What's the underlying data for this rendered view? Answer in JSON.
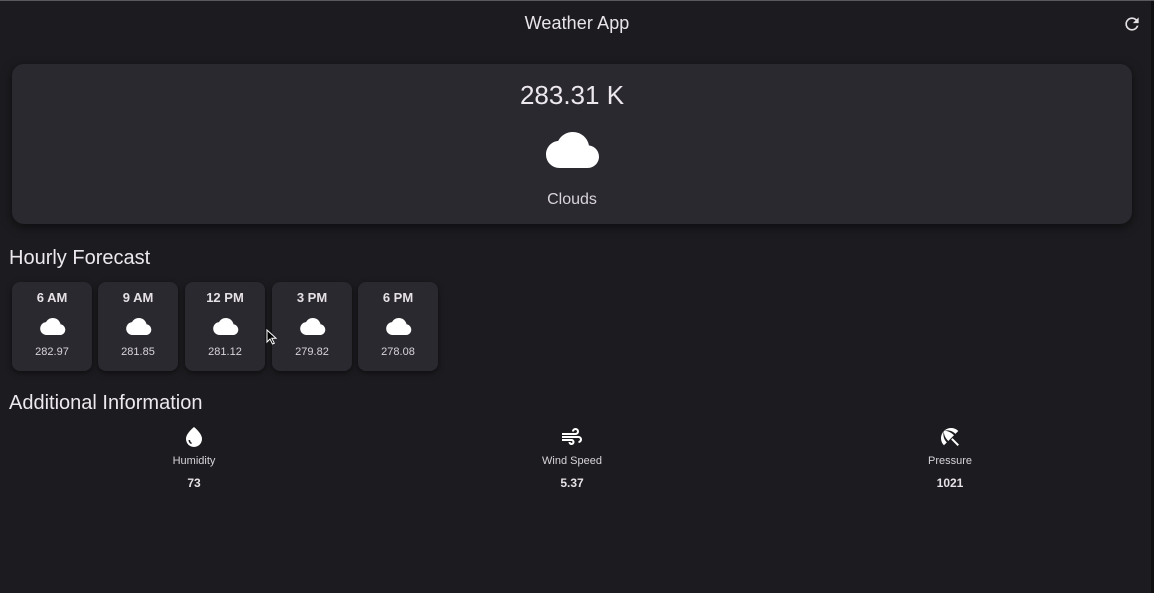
{
  "app": {
    "title": "Weather App",
    "refresh_icon": "refresh-icon"
  },
  "current": {
    "temperature": "283.31 K",
    "condition": "Clouds",
    "icon": "cloud-icon"
  },
  "hourly": {
    "title": "Hourly Forecast",
    "items": [
      {
        "time": "6 AM",
        "temp": "282.97",
        "icon": "cloud-icon"
      },
      {
        "time": "9 AM",
        "temp": "281.85",
        "icon": "cloud-icon"
      },
      {
        "time": "12 PM",
        "temp": "281.12",
        "icon": "cloud-icon"
      },
      {
        "time": "3 PM",
        "temp": "279.82",
        "icon": "cloud-icon"
      },
      {
        "time": "6 PM",
        "temp": "278.08",
        "icon": "cloud-icon"
      }
    ]
  },
  "additional": {
    "title": "Additional Information",
    "items": [
      {
        "label": "Humidity",
        "value": "73",
        "icon": "water-drop-icon"
      },
      {
        "label": "Wind Speed",
        "value": "5.37",
        "icon": "air-icon"
      },
      {
        "label": "Pressure",
        "value": "1021",
        "icon": "beach-umbrella-icon"
      }
    ]
  },
  "colors": {
    "background": "#1c1b1f",
    "card": "#2b2930",
    "text": "#e6e1e5"
  }
}
